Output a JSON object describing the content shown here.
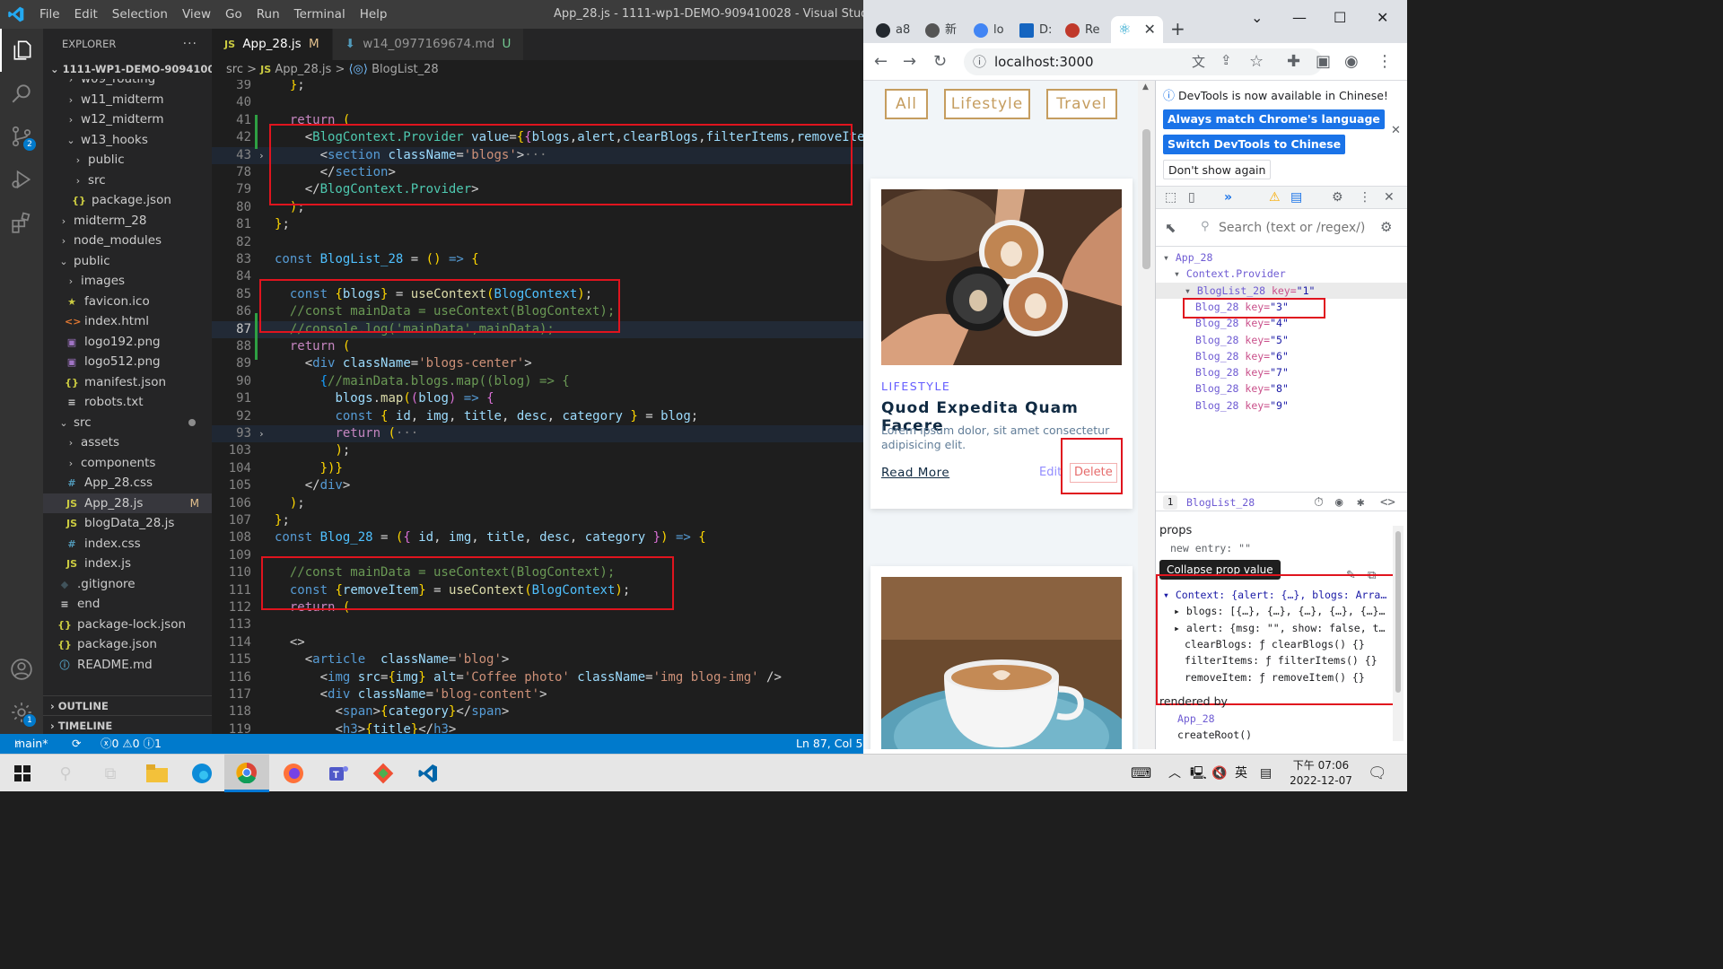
{
  "vscode": {
    "menu": [
      "File",
      "Edit",
      "Selection",
      "View",
      "Go",
      "Run",
      "Terminal",
      "Help"
    ],
    "window_title": "App_28.js - 1111-wp1-DEMO-909410028 - Visual Studio Code",
    "explorer": {
      "header": "EXPLORER",
      "root": "1111-WP1-DEMO-909410028",
      "items": [
        {
          "label": "w09_routing",
          "icon": "chevron-right"
        },
        {
          "label": "w11_midterm",
          "icon": "chevron-right"
        },
        {
          "label": "w12_midterm",
          "icon": "chevron-right"
        },
        {
          "label": "w13_hooks",
          "icon": "chevron-down"
        },
        {
          "label": "public",
          "icon": "chevron-right"
        },
        {
          "label": "src",
          "icon": "chevron-right"
        },
        {
          "label": "package.json",
          "icon": "json"
        },
        {
          "label": "midterm_28",
          "icon": "chevron-right"
        },
        {
          "label": "node_modules",
          "icon": "chevron-right"
        },
        {
          "label": "public",
          "icon": "chevron-down"
        },
        {
          "label": "images",
          "icon": "chevron-right"
        },
        {
          "label": "favicon.ico",
          "icon": "star"
        },
        {
          "label": "index.html",
          "icon": "html"
        },
        {
          "label": "logo192.png",
          "icon": "image"
        },
        {
          "label": "logo512.png",
          "icon": "image"
        },
        {
          "label": "manifest.json",
          "icon": "json"
        },
        {
          "label": "robots.txt",
          "icon": "text"
        },
        {
          "label": "src",
          "icon": "chevron-down"
        },
        {
          "label": "assets",
          "icon": "chevron-right"
        },
        {
          "label": "components",
          "icon": "chevron-right"
        },
        {
          "label": "App_28.css",
          "icon": "css"
        },
        {
          "label": "App_28.js",
          "icon": "js",
          "mark": "M"
        },
        {
          "label": "blogData_28.js",
          "icon": "js"
        },
        {
          "label": "index.css",
          "icon": "css"
        },
        {
          "label": "index.js",
          "icon": "js"
        },
        {
          "label": ".gitignore",
          "icon": "git"
        },
        {
          "label": "end",
          "icon": "text"
        },
        {
          "label": "package-lock.json",
          "icon": "json"
        },
        {
          "label": "package.json",
          "icon": "json"
        },
        {
          "label": "README.md",
          "icon": "info"
        }
      ],
      "outline": "OUTLINE",
      "timeline": "TIMELINE"
    },
    "tabs": [
      {
        "label": "App_28.js",
        "prefix": "JS",
        "suffix": "M"
      },
      {
        "label": "w14_0977169674.md",
        "prefix": "",
        "suffix": "U"
      }
    ],
    "breadcrumbs": [
      "src",
      ">",
      "JS",
      "App_28.js",
      ">",
      "BlogList_28"
    ],
    "code_lines": [
      {
        "n": "39",
        "html": "  };"
      },
      {
        "n": "40",
        "html": ""
      },
      {
        "n": "41",
        "html": "  return ("
      },
      {
        "n": "42",
        "html": "    <BlogContext.Provider value={{blogs,alert,clearBlogs,filterItems,removeItem}}>"
      },
      {
        "n": "43",
        "html": "      <section className='blogs'>···"
      },
      {
        "n": "78",
        "html": "      </section>"
      },
      {
        "n": "79",
        "html": "    </BlogContext.Provider>"
      },
      {
        "n": "80",
        "html": "  );"
      },
      {
        "n": "81",
        "html": "};"
      },
      {
        "n": "82",
        "html": ""
      },
      {
        "n": "83",
        "html": "const BlogList_28 = () => {"
      },
      {
        "n": "84",
        "html": ""
      },
      {
        "n": "85",
        "html": "  const {blogs} = useContext(BlogContext);"
      },
      {
        "n": "86",
        "html": "  //const mainData = useContext(BlogContext);"
      },
      {
        "n": "87",
        "html": "  //console.log('mainData',mainData);"
      },
      {
        "n": "88",
        "html": "  return ("
      },
      {
        "n": "89",
        "html": "    <div className='blogs-center'>"
      },
      {
        "n": "90",
        "html": "      {//mainData.blogs.map((blog) => {"
      },
      {
        "n": "91",
        "html": "        blogs.map((blog) => {"
      },
      {
        "n": "92",
        "html": "        const { id, img, title, desc, category } = blog;"
      },
      {
        "n": "93",
        "html": "        return (···"
      },
      {
        "n": "103",
        "html": "        );"
      },
      {
        "n": "104",
        "html": "      })}"
      },
      {
        "n": "105",
        "html": "    </div>"
      },
      {
        "n": "106",
        "html": "  );"
      },
      {
        "n": "107",
        "html": "};"
      },
      {
        "n": "108",
        "html": "const Blog_28 = ({ id, img, title, desc, category }) => {"
      },
      {
        "n": "109",
        "html": ""
      },
      {
        "n": "110",
        "html": "  //const mainData = useContext(BlogContext);"
      },
      {
        "n": "111",
        "html": "  const {removeItem} = useContext(BlogContext);"
      },
      {
        "n": "112",
        "html": "  return ("
      },
      {
        "n": "113",
        "html": ""
      },
      {
        "n": "114",
        "html": "  <>"
      },
      {
        "n": "115",
        "html": "    <article  className='blog'>"
      },
      {
        "n": "116",
        "html": "      <img src={img} alt='Coffee photo' className='img blog-img' />"
      },
      {
        "n": "117",
        "html": "      <div className='blog-content'>"
      },
      {
        "n": "118",
        "html": "        <span>{category}</span>"
      },
      {
        "n": "119",
        "html": "        <h3>{title}</h3>"
      }
    ],
    "status": {
      "branch": "main*",
      "problems": "ⓧ0 ⚠0 ⓘ1",
      "position": "Ln 87, Col 5"
    }
  },
  "chrome": {
    "tabs": [
      {
        "label": "a8",
        "color": "#24292f"
      },
      {
        "label": "新",
        "color": "#555555"
      },
      {
        "label": "lo",
        "color": "#4285f4"
      },
      {
        "label": "D:",
        "color": "#1565c0"
      },
      {
        "label": "Re",
        "color": "#c0392b"
      }
    ],
    "active_tab_icon": "react-icon",
    "url": "localhost:3000",
    "page": {
      "filters": [
        "All",
        "Lifestyle",
        "Travel"
      ],
      "card": {
        "category": "LIFESTYLE",
        "title": "Quod Expedita Quam Facere",
        "desc": "Lorem ipsum dolor, sit amet consectetur adipisicing elit.",
        "read_more": "Read More",
        "edit": "Edit",
        "delete": "Delete"
      }
    },
    "devtools": {
      "notice": "DevTools is now available in Chinese!",
      "btn_match": "Always match Chrome's language",
      "btn_switch": "Switch DevTools to Chinese",
      "btn_dont": "Don't show again",
      "search_placeholder": "Search (text or /regex/)",
      "tree": [
        {
          "name": "App_28",
          "key": "",
          "indent": 0,
          "arrow": "▾"
        },
        {
          "name": "Context.Provider",
          "key": "",
          "indent": 1,
          "arrow": "▾"
        },
        {
          "name": "BlogList_28",
          "key": "\"1\"",
          "indent": 2,
          "arrow": "▾"
        },
        {
          "name": "Blog_28",
          "key": "\"3\"",
          "indent": 3,
          "arrow": ""
        },
        {
          "name": "Blog_28",
          "key": "\"4\"",
          "indent": 3,
          "arrow": ""
        },
        {
          "name": "Blog_28",
          "key": "\"5\"",
          "indent": 3,
          "arrow": ""
        },
        {
          "name": "Blog_28",
          "key": "\"6\"",
          "indent": 3,
          "arrow": ""
        },
        {
          "name": "Blog_28",
          "key": "\"7\"",
          "indent": 3,
          "arrow": ""
        },
        {
          "name": "Blog_28",
          "key": "\"8\"",
          "indent": 3,
          "arrow": ""
        },
        {
          "name": "Blog_28",
          "key": "\"9\"",
          "indent": 3,
          "arrow": ""
        }
      ],
      "selected_component": "BlogList_28",
      "props_label": "props",
      "new_entry": "new entry: \"\"",
      "tooltip": "Collapse prop value",
      "context": [
        {
          "text": "▾ Context: {alert: {…}, blogs: Arra…",
          "indent": 0
        },
        {
          "text": "▸ blogs: [{…}, {…}, {…}, {…}, {…}…",
          "indent": 1
        },
        {
          "text": "▸ alert: {msg: \"\", show: false, t…",
          "indent": 1
        },
        {
          "text": "clearBlogs: ƒ clearBlogs() {}",
          "indent": 2
        },
        {
          "text": "filterItems: ƒ filterItems() {}",
          "indent": 2
        },
        {
          "text": "removeItem: ƒ removeItem() {}",
          "indent": 2
        }
      ],
      "rendered_by": "rendered by",
      "rendered": [
        "App_28",
        "createRoot()"
      ]
    }
  },
  "taskbar": {
    "time": "下午 07:06",
    "date": "2022-12-07",
    "ime": "英"
  },
  "colors": {
    "vscode_blue": "#007acc",
    "accent_gold": "#c59d5f",
    "highlight_red": "#e0141e"
  }
}
